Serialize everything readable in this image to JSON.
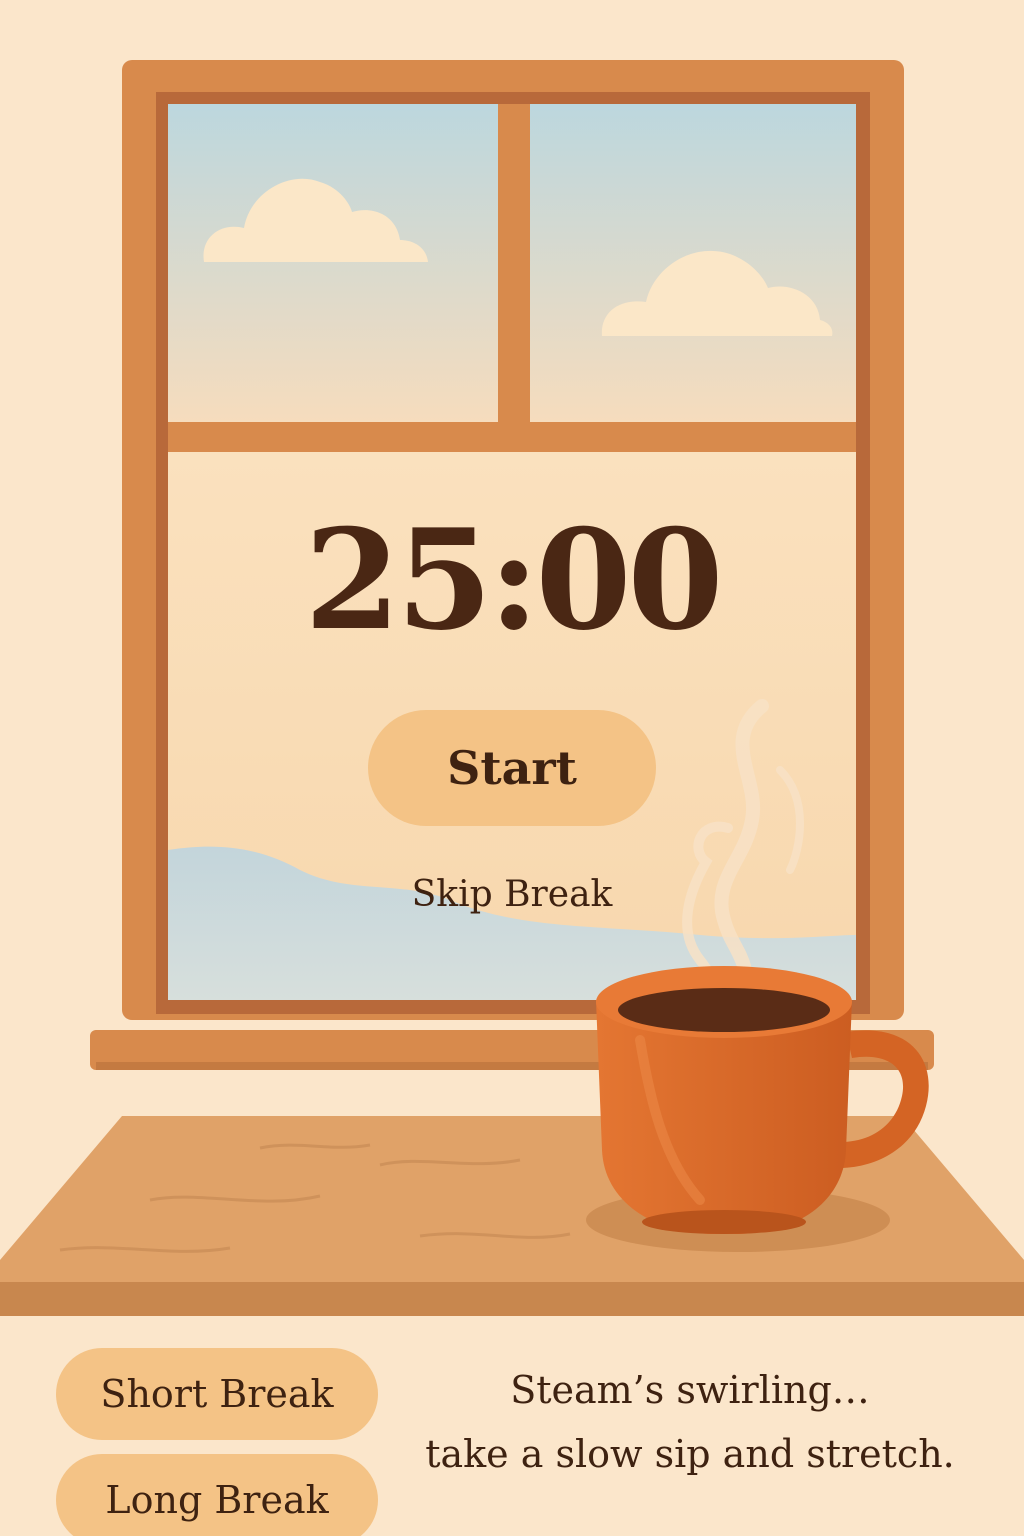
{
  "timer": {
    "display": "25:00"
  },
  "controls": {
    "start_label": "Start",
    "skip_label": "Skip Break"
  },
  "modes": {
    "short_break_label": "Short Break",
    "long_break_label": "Long Break"
  },
  "message": {
    "line1": "Steam’s swirling…",
    "line2": "take a slow sip and stretch."
  },
  "colors": {
    "background": "#fbe6cb",
    "window_frame": "#d88a4c",
    "sky": "#bcd7de",
    "accent_button": "#f4c386",
    "text_dark": "#3e2211",
    "mug": "#df6d2b"
  },
  "icons": {
    "mug": "coffee-mug-icon",
    "steam": "steam-icon",
    "clouds": "cloud-icon"
  }
}
